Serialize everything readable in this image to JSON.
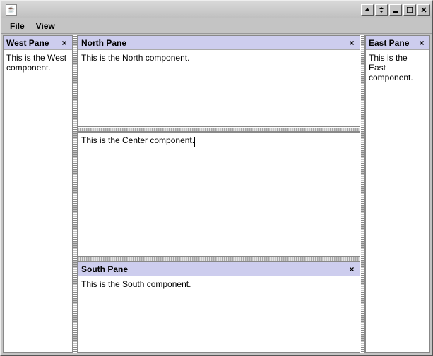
{
  "titlebar": {
    "title": ""
  },
  "menubar": {
    "file": "File",
    "view": "View"
  },
  "panes": {
    "west": {
      "title": "West Pane",
      "close": "×",
      "content": "This is the West component."
    },
    "east": {
      "title": "East Pane",
      "close": "×",
      "content": "This is the East component."
    },
    "north": {
      "title": "North Pane",
      "close": "×",
      "content": "This is the North component."
    },
    "south": {
      "title": "South Pane",
      "close": "×",
      "content": "This is the South component."
    },
    "center": {
      "content": "This is the Center component."
    }
  }
}
